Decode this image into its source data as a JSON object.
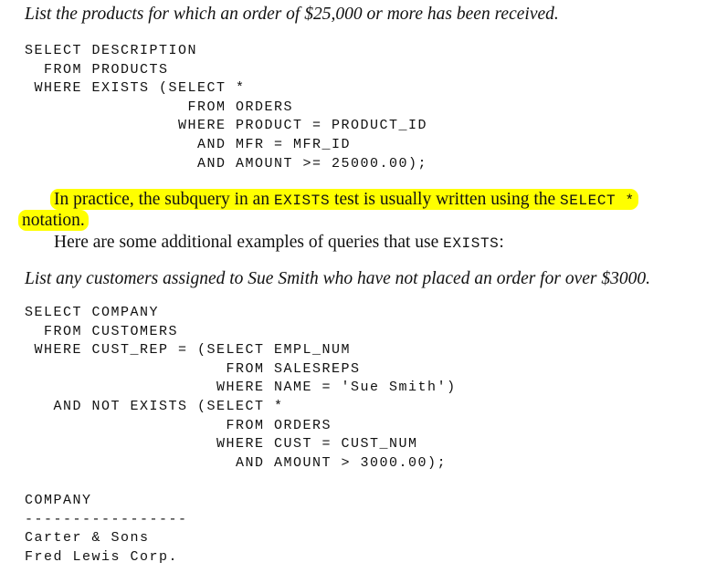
{
  "intro1": "List the products for which an order of $25,000 or more has been received.",
  "code1": [
    "SELECT DESCRIPTION",
    "  FROM PRODUCTS",
    " WHERE EXISTS (SELECT *",
    "                 FROM ORDERS",
    "                WHERE PRODUCT = PRODUCT_ID",
    "                  AND MFR = MFR_ID",
    "                  AND AMOUNT >= 25000.00);"
  ],
  "highlight": {
    "part1": "In practice, the subquery in an ",
    "code1": "EXISTS",
    "part2": " test is usually written using the ",
    "code2": "SELECT *",
    "part3": "notation.",
    "color": "#ffff00"
  },
  "para2": {
    "text": "Here are some additional examples of queries that use ",
    "code": "EXISTS",
    "end": ":"
  },
  "intro2": "List any customers assigned to Sue Smith who have not placed an order for over $3000.",
  "code2": [
    "SELECT COMPANY",
    "  FROM CUSTOMERS",
    " WHERE CUST_REP = (SELECT EMPL_NUM",
    "                     FROM SALESREPS",
    "                    WHERE NAME = 'Sue Smith')",
    "   AND NOT EXISTS (SELECT *",
    "                     FROM ORDERS",
    "                    WHERE CUST = CUST_NUM",
    "                      AND AMOUNT > 3000.00);"
  ],
  "result": [
    "COMPANY",
    "-----------------",
    "Carter & Sons",
    "Fred Lewis Corp."
  ]
}
